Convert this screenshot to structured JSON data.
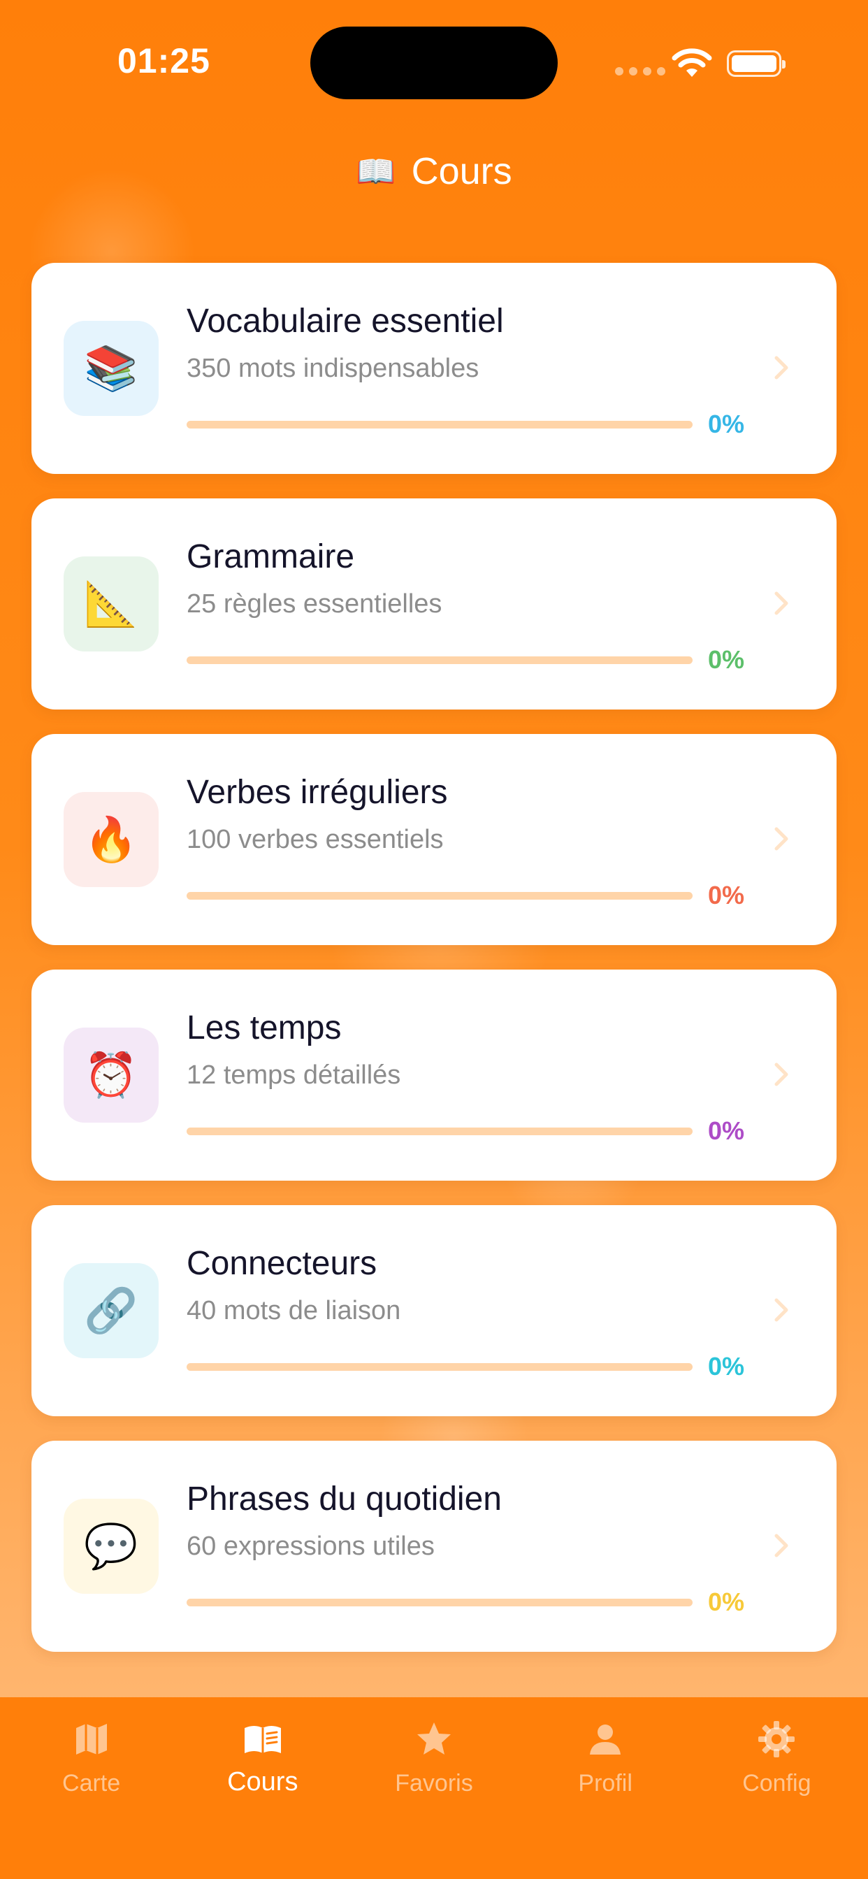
{
  "status_bar": {
    "time": "01:25"
  },
  "header": {
    "icon": "📖",
    "title": "Cours"
  },
  "courses": [
    {
      "icon": "📚",
      "icon_bg": "#e5f4fd",
      "title": "Vocabulaire essentiel",
      "subtitle": "350 mots indispensables",
      "progress_value": 0,
      "progress_label": "0%",
      "accent": "#35b6e6"
    },
    {
      "icon": "📐",
      "icon_bg": "#e8f5ea",
      "title": "Grammaire",
      "subtitle": "25 règles essentielles",
      "progress_value": 0,
      "progress_label": "0%",
      "accent": "#5cbf6a"
    },
    {
      "icon": "🔥",
      "icon_bg": "#fdecea",
      "title": "Verbes irréguliers",
      "subtitle": "100 verbes essentiels",
      "progress_value": 0,
      "progress_label": "0%",
      "accent": "#f26a4b"
    },
    {
      "icon": "⏰",
      "icon_bg": "#f4e8f7",
      "title": "Les temps",
      "subtitle": "12 temps détaillés",
      "progress_value": 0,
      "progress_label": "0%",
      "accent": "#ad4cc7"
    },
    {
      "icon": "🔗",
      "icon_bg": "#e3f6fa",
      "title": "Connecteurs",
      "subtitle": "40 mots de liaison",
      "progress_value": 0,
      "progress_label": "0%",
      "accent": "#2bc4d9"
    },
    {
      "icon": "💬",
      "icon_bg": "#fff8e3",
      "title": "Phrases du quotidien",
      "subtitle": "60 expressions utiles",
      "progress_value": 0,
      "progress_label": "0%",
      "accent": "#f7c938"
    }
  ],
  "tab_bar": {
    "tabs": [
      {
        "label": "Carte",
        "icon": "map-icon",
        "active": false
      },
      {
        "label": "Cours",
        "icon": "book-icon",
        "active": true
      },
      {
        "label": "Favoris",
        "icon": "star-icon",
        "active": false
      },
      {
        "label": "Profil",
        "icon": "person-icon",
        "active": false
      },
      {
        "label": "Config",
        "icon": "gear-icon",
        "active": false
      }
    ]
  },
  "colors": {
    "background": "#ff7f0a",
    "progress_track": "#ffd4a8",
    "title_text": "#15142a",
    "subtitle_text": "#8c8c8c"
  }
}
